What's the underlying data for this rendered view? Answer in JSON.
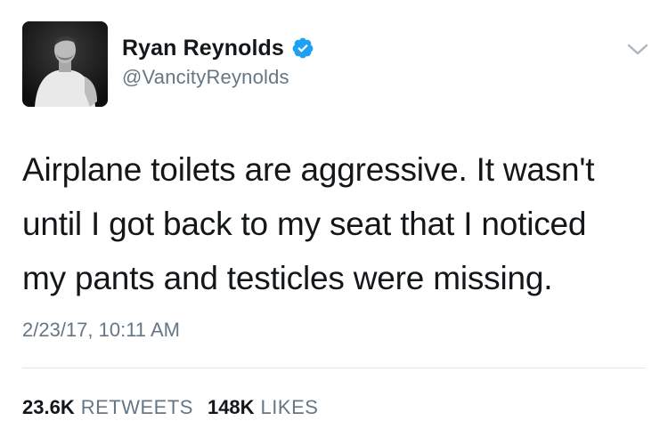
{
  "author": {
    "display_name": "Ryan Reynolds",
    "handle": "@VancityReynolds",
    "verified": true,
    "avatar_icon": "profile-photo-grayscale",
    "verified_badge_color": "#1da1f2"
  },
  "tweet": {
    "text_lines": [
      "Airplane toilets are aggressive. It wasn't",
      "until I got back to my seat that I noticed",
      "my pants and testicles were missing."
    ],
    "timestamp": "2/23/17, 10:11 AM"
  },
  "stats": {
    "retweets_count": "23.6K",
    "retweets_label": "RETWEETS",
    "likes_count": "148K",
    "likes_label": "LIKES"
  },
  "menu_icon": "chevron-down-icon"
}
